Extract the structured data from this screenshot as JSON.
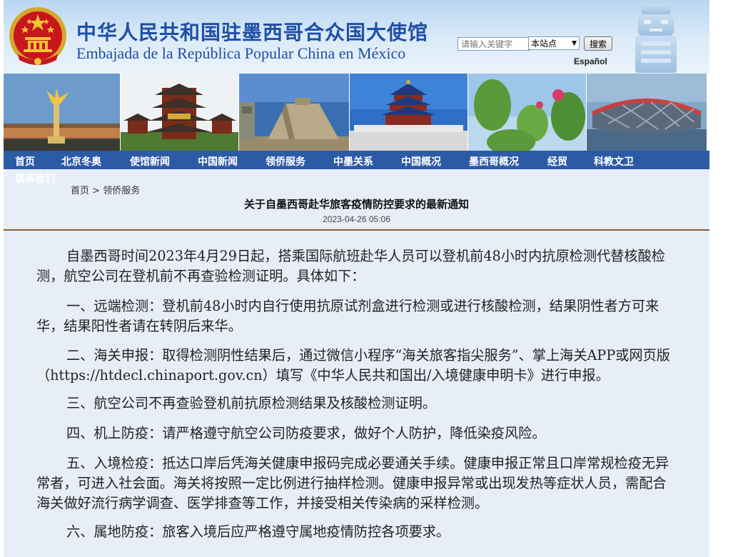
{
  "header": {
    "title_cn": "中华人民共和国驻墨西哥合众国大使馆",
    "title_es": "Embajada de la República Popular China en México",
    "search_placeholder": "请输入关键字",
    "scope_selected": "本站点",
    "search_label": "搜索",
    "lang_link": "Español"
  },
  "nav": {
    "items": [
      "首页",
      "北京冬奥",
      "使馆新闻",
      "中国新闻",
      "领侨服务",
      "中墨关系",
      "中国概况",
      "墨西哥概况",
      "经贸",
      "科教文卫"
    ],
    "contact": "联系我们"
  },
  "breadcrumb": {
    "home": "首页",
    "sep": " > ",
    "current": "领侨服务"
  },
  "article": {
    "title": "关于自墨西哥赴华旅客疫情防控要求的最新通知",
    "date": "2023-04-26 05:06",
    "paragraphs": [
      "自墨西哥时间2023年4月29日起，搭乘国际航班赴华人员可以登机前48小时内抗原检测代替核酸检测，航空公司在登机前不再查验检测证明。具体如下：",
      "一、远端检测：登机前48小时内自行使用抗原试剂盒进行检测或进行核酸检测，结果阴性者方可来华，结果阳性者请在转阴后来华。",
      "二、海关申报：取得检测阴性结果后，通过微信小程序“海关旅客指尖服务”、掌上海关APP或网页版（https://htdecl.chinaport.gov.cn）填写《中华人民共和国出/入境健康申明卡》进行申报。",
      "三、航空公司不再查验登机前抗原检测结果及核酸检测证明。",
      "四、机上防疫：请严格遵守航空公司防疫要求，做好个人防护，降低染疫风险。",
      "五、入境检疫：抵达口岸后凭海关健康申报码完成必要通关手续。健康申报正常且口岸常规检疫无异常者，可进入社会面。海关将按照一定比例进行抽样检测。健康申报异常或出现发热等症状人员，需配合海关做好流行病学调查、医学排查等工作，并接受相关传染病的采样检测。",
      "六、属地防疫：旅客入境后应严格遵守属地疫情防控各项要求。"
    ]
  },
  "colors": {
    "nav_bg": "#2d5aa4",
    "title_blue": "#1f4fa5",
    "divider": "#8a5a3c",
    "page_bg": "#e8eef7"
  }
}
